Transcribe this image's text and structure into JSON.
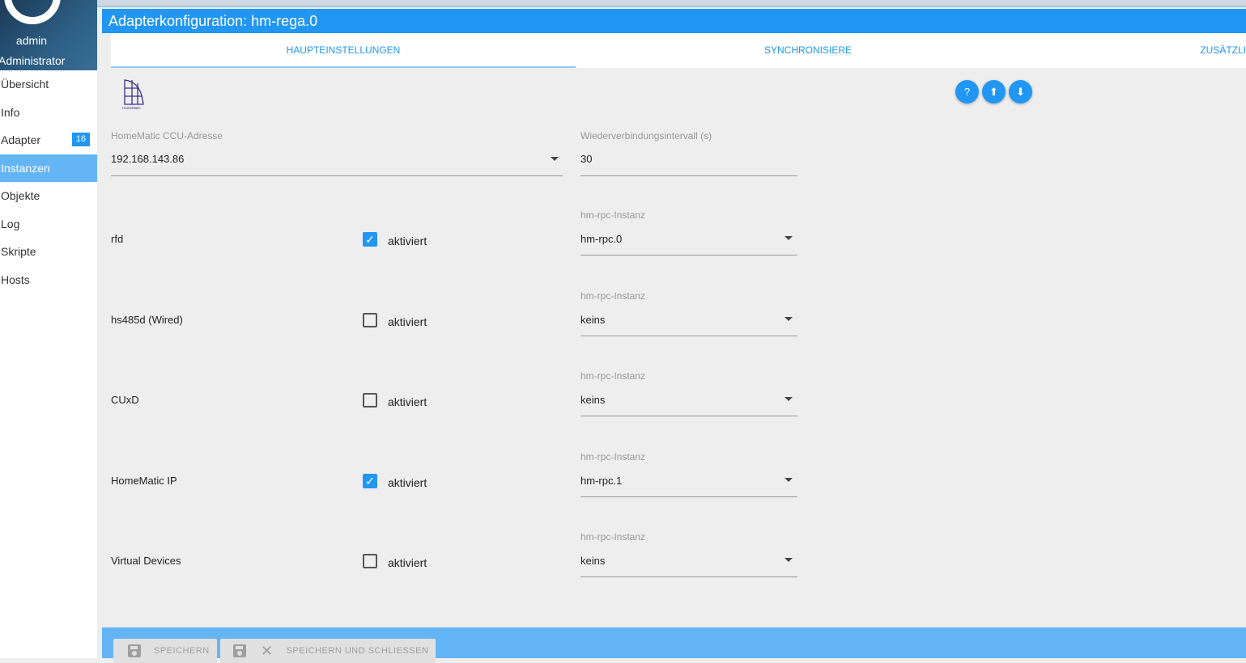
{
  "user": {
    "name": "admin",
    "role": "Administrator"
  },
  "nav": [
    {
      "label": "Übersicht"
    },
    {
      "label": "Info"
    },
    {
      "label": "Adapter",
      "badge": "16"
    },
    {
      "label": "Instanzen",
      "active": true
    },
    {
      "label": "Objekte"
    },
    {
      "label": "Log"
    },
    {
      "label": "Skripte"
    },
    {
      "label": "Hosts"
    }
  ],
  "title": "Adapterkonfiguration: hm-rega.0",
  "tabs": [
    "HAUPTEINSTELLUNGEN",
    "SYNCHRONISIERE",
    "ZUSÄTZLI"
  ],
  "logo_text": "HomeMatic",
  "fields": {
    "ccu_label": "HomeMatic CCU-Adresse",
    "ccu_value": "192.168.143.86",
    "reconnect_label": "Wiederverbindungsintervall (s)",
    "reconnect_value": "30"
  },
  "rows": [
    {
      "name": "rfd",
      "checked": true,
      "check_label": "aktiviert",
      "instance_label": "hm-rpc-Instanz",
      "instance": "hm-rpc.0"
    },
    {
      "name": "hs485d (Wired)",
      "checked": false,
      "check_label": "aktiviert",
      "instance_label": "hm-rpc-Instanz",
      "instance": "keins"
    },
    {
      "name": "CUxD",
      "checked": false,
      "check_label": "aktiviert",
      "instance_label": "hm-rpc-Instanz",
      "instance": "keins"
    },
    {
      "name": "HomeMatic IP",
      "checked": true,
      "check_label": "aktiviert",
      "instance_label": "hm-rpc-Instanz",
      "instance": "hm-rpc.1"
    },
    {
      "name": "Virtual Devices",
      "checked": false,
      "check_label": "aktiviert",
      "instance_label": "hm-rpc-Instanz",
      "instance": "keins"
    }
  ],
  "buttons": {
    "save": "SPEICHERN",
    "save_close": "SPEICHERN UND SCHLIESSEN"
  },
  "colors": {
    "primary": "#2196f3",
    "light": "#64b5f6"
  }
}
